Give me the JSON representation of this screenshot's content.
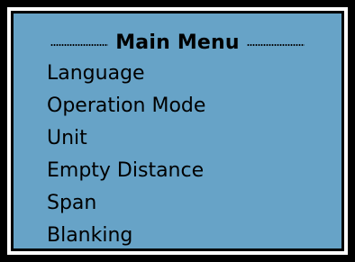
{
  "menu": {
    "title": "Main Menu",
    "items": [
      {
        "label": "Language"
      },
      {
        "label": "Operation Mode"
      },
      {
        "label": "Unit"
      },
      {
        "label": "Empty Distance"
      },
      {
        "label": "Span"
      },
      {
        "label": "Blanking"
      }
    ]
  },
  "colors": {
    "screen_background": "#67a3c7",
    "frame": "#000000",
    "text": "#000000"
  }
}
